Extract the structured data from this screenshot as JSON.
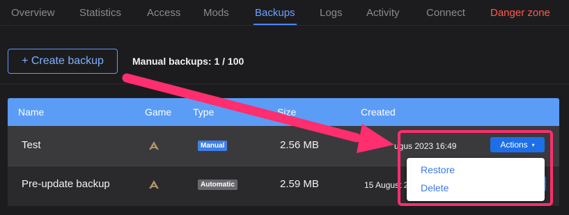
{
  "tabs": [
    {
      "label": "Overview"
    },
    {
      "label": "Statistics"
    },
    {
      "label": "Access"
    },
    {
      "label": "Mods"
    },
    {
      "label": "Backups"
    },
    {
      "label": "Logs"
    },
    {
      "label": "Activity"
    },
    {
      "label": "Connect"
    },
    {
      "label": "Danger zone"
    }
  ],
  "active_tab": "Backups",
  "toolbar": {
    "create_label": "+ Create backup",
    "manual_count": "Manual backups: 1 / 100"
  },
  "table": {
    "headers": {
      "name": "Name",
      "game": "Game",
      "type": "Type",
      "size": "Size",
      "created": "Created"
    },
    "rows": [
      {
        "name": "Test",
        "type": "Manual",
        "size": "2.56 MB",
        "created": "ugus  2023 16:49",
        "game_icon": "ark-game-icon",
        "actions_label": "Actions"
      },
      {
        "name": "Pre-update backup",
        "type": "Automatic",
        "size": "2.59 MB",
        "created": "15 August 2",
        "game_icon": "ark-game-icon"
      }
    ]
  },
  "dropdown": {
    "items": [
      {
        "label": "Restore"
      },
      {
        "label": "Delete"
      }
    ]
  },
  "colors": {
    "accent": "#4a86ff",
    "danger": "#ff5a4d",
    "header_bg": "#5b9cf6",
    "annotation": "#ff2e6e"
  }
}
